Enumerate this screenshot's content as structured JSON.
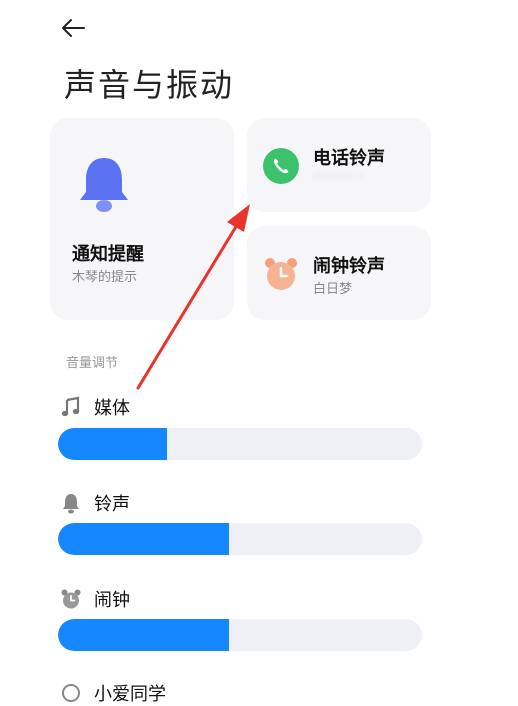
{
  "header": {
    "title": "声音与振动"
  },
  "cards": {
    "notify": {
      "title": "通知提醒",
      "subtitle": "木琴的提示"
    },
    "call": {
      "title": "电话铃声",
      "subtitle": "········ ·"
    },
    "alarm": {
      "title": "闹钟铃声",
      "subtitle": "白日梦"
    }
  },
  "volume": {
    "section_label": "音量调节",
    "items": [
      {
        "label": "媒体",
        "level": 0.3
      },
      {
        "label": "铃声",
        "level": 0.47
      },
      {
        "label": "闹钟",
        "level": 0.47
      },
      {
        "label": "小爱同学"
      }
    ]
  },
  "colors": {
    "accent": "#1688ff",
    "track": "#eef0f6",
    "card_bg": "#f6f6f8",
    "bell": "#5b72f2",
    "phone": "#3bc26b",
    "alarm": "#f4a07d",
    "annotation_arrow": "#e8342b"
  },
  "icons": {
    "back": "arrow-left-icon",
    "notify": "bell-icon",
    "call": "phone-icon",
    "alarm": "alarm-clock-icon",
    "media": "music-note-icon",
    "ring": "bell-small-icon",
    "alarm_small": "alarm-small-icon",
    "xiaoai": "xiaoai-icon"
  }
}
